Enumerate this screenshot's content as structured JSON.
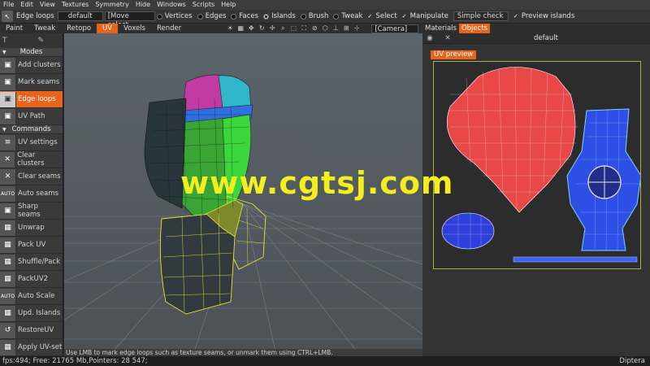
{
  "menu": [
    "File",
    "Edit",
    "View",
    "Textures",
    "Symmetry",
    "Hide",
    "Windows",
    "Scripts",
    "Help"
  ],
  "optbar": {
    "tool_label": "Edge loops",
    "preset": "default",
    "move_select": "[Move select",
    "radios": [
      "Vertices",
      "Edges",
      "Faces",
      "Islands",
      "Brush",
      "Tweak"
    ],
    "checks": [
      "Select",
      "Manipulate"
    ],
    "simple_check": "Simple check",
    "preview_islands": "Preview islands"
  },
  "rooms": [
    "Paint",
    "Tweak",
    "Retopo",
    "UV",
    "Voxels",
    "Render"
  ],
  "active_room": "UV",
  "camera": "[Camera]",
  "right_tabs": [
    "Materials",
    "Objects"
  ],
  "right_panel": {
    "title": "default",
    "uv_tab": "UV preview"
  },
  "left_panel": {
    "modes_label": "Modes",
    "commands_label": "Commands",
    "modes": [
      {
        "label": "Add clusters",
        "icon": "cube-icon",
        "glyph": "▣"
      },
      {
        "label": "Mark seams",
        "icon": "cube-icon",
        "glyph": "▣"
      },
      {
        "label": "Edge loops",
        "icon": "cube-icon",
        "glyph": "▣",
        "active": true
      },
      {
        "label": "UV Path",
        "icon": "cube-icon",
        "glyph": "▣"
      }
    ],
    "commands": [
      {
        "label": "UV settings",
        "glyph": "≡"
      },
      {
        "label": "Clear clusters",
        "glyph": "✕"
      },
      {
        "label": "Clear seams",
        "glyph": "✕"
      },
      {
        "label": "Auto seams",
        "glyph": "AUTO"
      },
      {
        "label": "Sharp seams",
        "glyph": "▣"
      },
      {
        "label": "Unwrap",
        "glyph": "▦"
      },
      {
        "label": "Pack UV",
        "glyph": "▦"
      },
      {
        "label": "Shuffle/Pack",
        "glyph": "▦"
      },
      {
        "label": "PackUV2",
        "glyph": "▦"
      },
      {
        "label": "Auto Scale",
        "glyph": "AUTO"
      },
      {
        "label": "Upd. Islands",
        "glyph": "▦"
      },
      {
        "label": "RestoreUV",
        "glyph": "↺"
      },
      {
        "label": "Apply UV-set",
        "glyph": "▦"
      }
    ]
  },
  "hint": "Use LMB to mark edge loops such as texture seams, or unmark them using CTRL+LMB.",
  "status": "fps:494;  Free: 21765 Mb,Pointers: 28 547;",
  "brand": "Diptera",
  "watermark": "www.cgtsj.com",
  "colors": {
    "accent": "#e8641c",
    "watermark": "#f3ee1e"
  }
}
